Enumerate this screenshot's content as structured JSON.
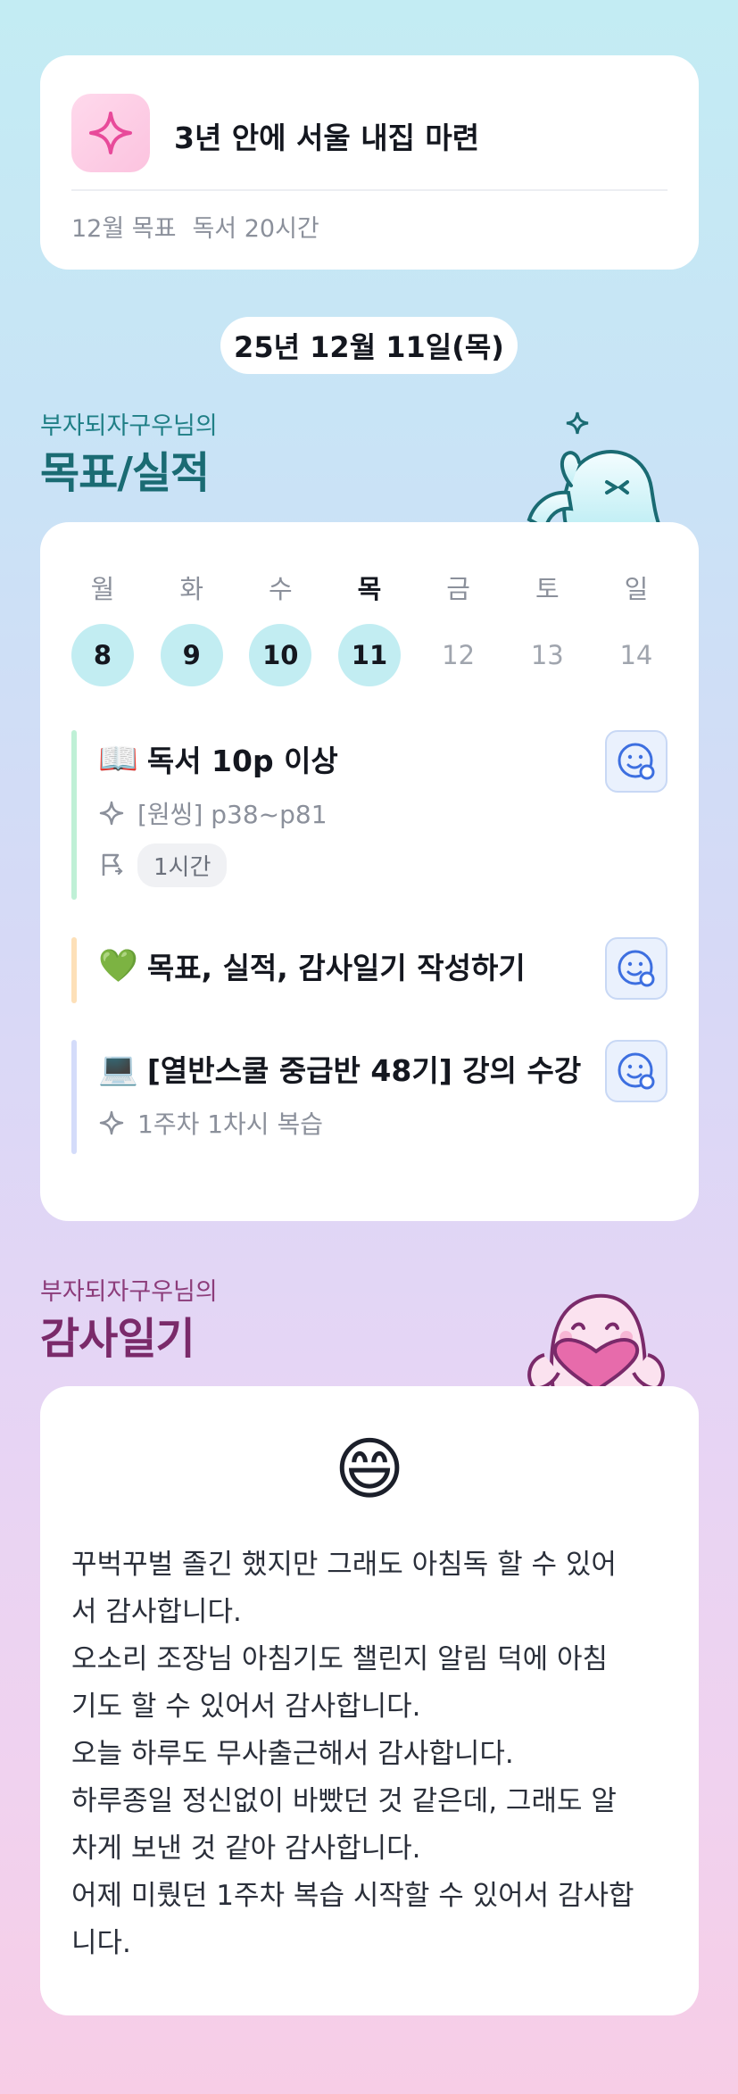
{
  "goal_card": {
    "icon": "sparkle-icon",
    "title": "3년 안에 서울 내집 마련",
    "month_label": "12월 목표",
    "month_goal": "독서 20시간"
  },
  "date": "25년 12월 11일(목)",
  "performance": {
    "owner_label": "부자되자구우님의",
    "title": "목표/실적",
    "week_labels": [
      "월",
      "화",
      "수",
      "목",
      "금",
      "토",
      "일"
    ],
    "week_days": [
      "8",
      "9",
      "10",
      "11",
      "12",
      "13",
      "14"
    ],
    "completed_days": [
      "8",
      "9",
      "10",
      "11"
    ],
    "today_label": "목",
    "tasks": [
      {
        "emoji": "📖",
        "title": "독서 10p 이상",
        "detail": "[원씽] p38~p81",
        "time": "1시간",
        "bar_color": "#bff0d6"
      },
      {
        "emoji": "💚",
        "title": "목표, 실적, 감사일기 작성하기",
        "bar_color": "#fde0b8"
      },
      {
        "emoji": "💻",
        "title": "[열반스쿨 중급반 48기] 강의 수강",
        "detail": "1주차 1차시 복습",
        "bar_color": "#d4dcfa"
      }
    ]
  },
  "diary": {
    "owner_label": "부자되자구우님의",
    "title": "감사일기",
    "emoji": "😄",
    "lines": [
      "꾸벅꾸벌 졸긴 했지만 그래도 아침독 할 수 있어",
      "서 감사합니다.",
      "오소리 조장님 아침기도 챌린지 알림 덕에 아침",
      "기도 할 수 있어서 감사합니다.",
      "오늘 하루도 무사출근해서 감사합니다.",
      "하루종일 정신없이 바빴던 것 같은데, 그래도 알",
      "차게 보낸 것 같아 감사합니다.",
      "어제 미뤘던 1주차 복습 시작할 수 있어서 감사합",
      "니다."
    ]
  }
}
